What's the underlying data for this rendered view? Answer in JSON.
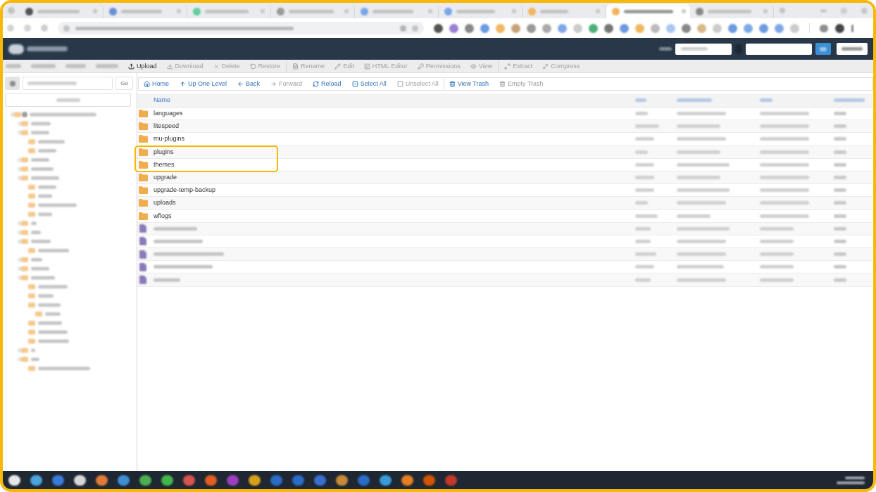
{
  "browser": {
    "tabs": [
      {
        "selected": false
      },
      {
        "selected": false
      },
      {
        "selected": false
      },
      {
        "selected": false
      },
      {
        "selected": false
      },
      {
        "selected": false
      },
      {
        "selected": false
      },
      {
        "selected": true
      },
      {
        "selected": false
      }
    ]
  },
  "file_manager": {
    "actions_toolbar": {
      "groups": [
        {
          "items": [
            {
              "kind": "blurred"
            },
            {
              "kind": "blurred"
            },
            {
              "kind": "blurred"
            },
            {
              "kind": "blurred"
            },
            {
              "kind": "button",
              "label": "Upload",
              "disabled": false
            },
            {
              "kind": "button",
              "label": "Download",
              "disabled": true
            },
            {
              "kind": "button",
              "label": "Delete",
              "disabled": true
            },
            {
              "kind": "button",
              "label": "Restore",
              "disabled": true
            }
          ]
        },
        {
          "items": [
            {
              "kind": "button",
              "label": "Rename",
              "disabled": true
            },
            {
              "kind": "button",
              "label": "Edit",
              "disabled": true
            },
            {
              "kind": "button",
              "label": "HTML Editor",
              "disabled": true
            },
            {
              "kind": "button",
              "label": "Permissions",
              "disabled": true
            },
            {
              "kind": "button",
              "label": "View",
              "disabled": true
            }
          ]
        },
        {
          "items": [
            {
              "kind": "button",
              "label": "Extract",
              "disabled": true
            },
            {
              "kind": "button",
              "label": "Compress",
              "disabled": true
            }
          ]
        }
      ]
    },
    "sidebar": {
      "go_button": "Go"
    },
    "nav_toolbar": {
      "groups": [
        {
          "items": [
            {
              "label": "Home",
              "disabled": false
            },
            {
              "label": "Up One Level",
              "disabled": false
            },
            {
              "label": "Back",
              "disabled": false
            },
            {
              "label": "Forward",
              "disabled": true
            },
            {
              "label": "Reload",
              "disabled": false
            },
            {
              "label": "Select All",
              "disabled": false
            },
            {
              "label": "Unselect All",
              "disabled": true
            }
          ]
        },
        {
          "items": [
            {
              "label": "View Trash",
              "disabled": false
            },
            {
              "label": "Empty Trash",
              "disabled": true
            }
          ]
        }
      ]
    },
    "table": {
      "columns": [
        {
          "kind": "text",
          "label": "Name"
        },
        {
          "kind": "blurred"
        },
        {
          "kind": "blurred"
        },
        {
          "kind": "blurred"
        },
        {
          "kind": "blurred"
        }
      ],
      "rows": [
        {
          "kind": "folder",
          "name": "languages",
          "highlighted": false
        },
        {
          "kind": "folder",
          "name": "litespeed",
          "highlighted": false
        },
        {
          "kind": "folder",
          "name": "mu-plugins",
          "highlighted": false
        },
        {
          "kind": "folder",
          "name": "plugins",
          "highlighted": true
        },
        {
          "kind": "folder",
          "name": "themes",
          "highlighted": true
        },
        {
          "kind": "folder",
          "name": "upgrade",
          "highlighted": false
        },
        {
          "kind": "folder",
          "name": "upgrade-temp-backup",
          "highlighted": false
        },
        {
          "kind": "folder",
          "name": "uploads",
          "highlighted": false
        },
        {
          "kind": "folder",
          "name": "wflogs",
          "highlighted": false
        },
        {
          "kind": "file",
          "highlighted": false
        },
        {
          "kind": "file",
          "highlighted": false
        },
        {
          "kind": "file",
          "highlighted": false
        },
        {
          "kind": "file",
          "highlighted": false
        },
        {
          "kind": "file",
          "highlighted": false
        }
      ]
    }
  }
}
